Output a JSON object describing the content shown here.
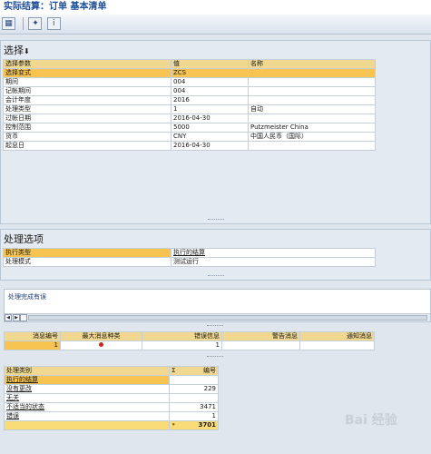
{
  "window": {
    "title": "实际结算：订单 基本清单"
  },
  "toolbar": {
    "icons": [
      "grid-icon",
      "settings-icon",
      "info-icon"
    ]
  },
  "selection": {
    "heading": "选择",
    "columns": [
      "选择参数",
      "值",
      "名称"
    ],
    "rows": [
      {
        "param": "选择变式",
        "value": "ZCS",
        "name": ""
      },
      {
        "param": "期间",
        "value": "004",
        "name": ""
      },
      {
        "param": "记帐期间",
        "value": "004",
        "name": ""
      },
      {
        "param": "会计年度",
        "value": "2016",
        "name": ""
      },
      {
        "param": "处理类型",
        "value": "1",
        "name": "自动"
      },
      {
        "param": "过帐日期",
        "value": "2016-04-30",
        "name": ""
      },
      {
        "param": "控制范围",
        "value": "5000",
        "name": "Putzmeister China"
      },
      {
        "param": "货币",
        "value": "CNY",
        "name": "中国人民币（国际）"
      },
      {
        "param": "起息日",
        "value": "2016-04-30",
        "name": ""
      }
    ]
  },
  "processing": {
    "heading": "处理选项",
    "rows": [
      {
        "label": "执行类型",
        "value": "执行的结算"
      },
      {
        "label": "处理模式",
        "value": "测试运行"
      }
    ]
  },
  "messages": {
    "text": "处理完成有误"
  },
  "msg_summary": {
    "columns": [
      "消息编号",
      "最大消息种类",
      "错误信息",
      "警告消息",
      "通知消息"
    ],
    "row": {
      "msg_no": "1",
      "max_type": "error",
      "errors": "1",
      "warnings": "",
      "notices": ""
    }
  },
  "result": {
    "columns": [
      "处理类别",
      "Σ",
      "编号"
    ],
    "rows": [
      {
        "category": "执行的结算",
        "count": ""
      },
      {
        "category": "没有更改",
        "count": "229"
      },
      {
        "category": "无关",
        "count": ""
      },
      {
        "category": "不适当的状态",
        "count": "3471"
      },
      {
        "category": "错误",
        "count": "1"
      }
    ],
    "total_marker": "•",
    "total": "3701"
  },
  "watermark": "Bai 经验"
}
